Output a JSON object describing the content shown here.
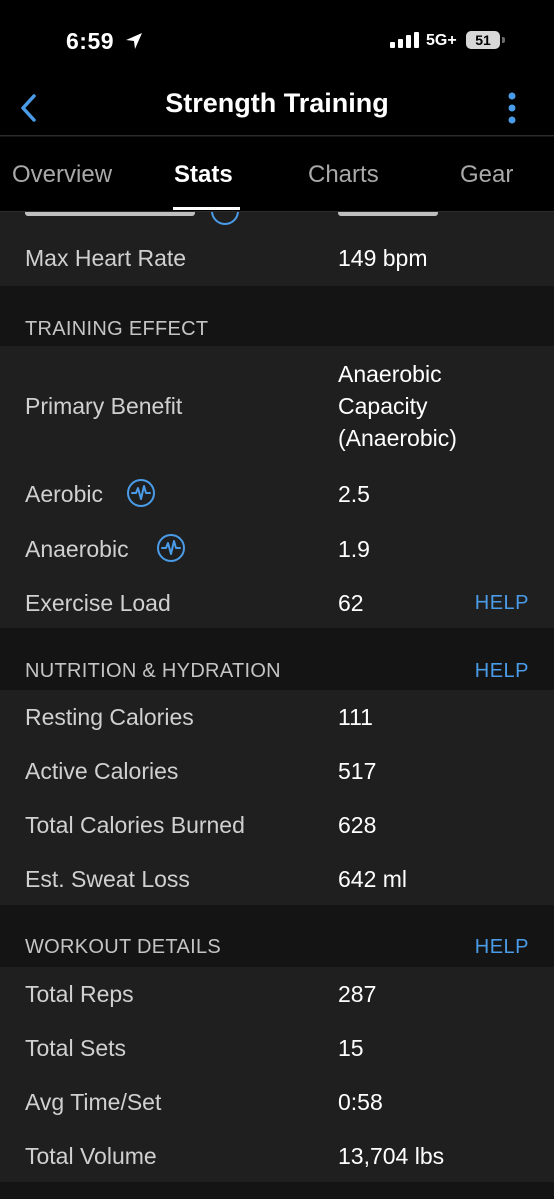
{
  "status": {
    "time": "6:59",
    "network": "5G+",
    "battery": "51"
  },
  "nav": {
    "title": "Strength Training"
  },
  "tabs": [
    {
      "label": "Overview"
    },
    {
      "label": "Stats"
    },
    {
      "label": "Charts"
    },
    {
      "label": "Gear"
    }
  ],
  "heart": {
    "max_label": "Max Heart Rate",
    "max_value": "149 bpm"
  },
  "training": {
    "title": "TRAINING EFFECT",
    "primary_label": "Primary Benefit",
    "primary_value": [
      "Anaerobic",
      "Capacity",
      "(Anaerobic)"
    ],
    "aerobic_label": "Aerobic",
    "aerobic_value": "2.5",
    "anaerobic_label": "Anaerobic",
    "anaerobic_value": "1.9",
    "load_label": "Exercise Load",
    "load_value": "62",
    "help": "HELP"
  },
  "nutrition": {
    "title": "NUTRITION & HYDRATION",
    "help": "HELP",
    "rows": [
      {
        "label": "Resting Calories",
        "value": "111"
      },
      {
        "label": "Active Calories",
        "value": "517"
      },
      {
        "label": "Total Calories Burned",
        "value": "628"
      },
      {
        "label": "Est. Sweat Loss",
        "value": "642 ml"
      }
    ]
  },
  "workout": {
    "title": "WORKOUT DETAILS",
    "help": "HELP",
    "rows": [
      {
        "label": "Total Reps",
        "value": "287"
      },
      {
        "label": "Total Sets",
        "value": "15"
      },
      {
        "label": "Avg Time/Set",
        "value": "0:58"
      },
      {
        "label": "Total Volume",
        "value": "13,704 lbs"
      }
    ]
  },
  "colors": {
    "accent": "#4a9ce8",
    "background": "#141414",
    "card": "#1f1f1f"
  },
  "icons": [
    "location-arrow-icon",
    "signal-icon",
    "battery-icon",
    "back-chevron-icon",
    "more-vertical-icon",
    "training-effect-info-icon"
  ]
}
